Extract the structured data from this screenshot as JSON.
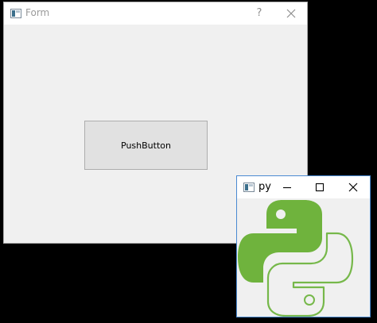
{
  "form_window": {
    "title": "Form",
    "help_glyph": "?",
    "icons": {
      "app": "qt-window-icon",
      "close": "close-icon"
    },
    "button_label": "PushButton"
  },
  "py_window": {
    "title": "py",
    "icons": {
      "app": "qt-window-icon",
      "minimize": "minimize-icon",
      "maximize": "maximize-icon",
      "close": "close-icon"
    },
    "image": "python-logo"
  },
  "colors": {
    "desktop": "#000000",
    "window_bg": "#f0f0f0",
    "titlebar_bg": "#ffffff",
    "button_bg": "#e1e1e1",
    "logo_green": "#6fb33d",
    "logo_outline": "#76b84a",
    "active_border": "#4a8ad2"
  }
}
